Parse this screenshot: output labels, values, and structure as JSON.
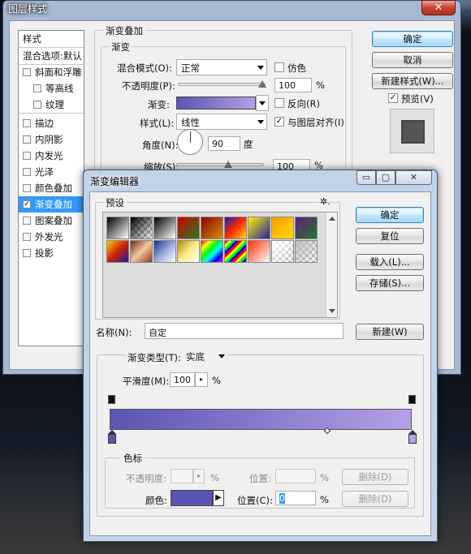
{
  "layer_style": {
    "title": "图层样式",
    "close_glyph": "✕",
    "list_header": "样式",
    "list_items": [
      {
        "label": "混合选项:默认",
        "checkbox": false,
        "checked": false,
        "selected": false
      },
      {
        "label": "斜面和浮雕",
        "checkbox": true,
        "checked": false,
        "selected": false
      },
      {
        "label": "等高线",
        "checkbox": true,
        "checked": false,
        "selected": false
      },
      {
        "label": "纹理",
        "checkbox": true,
        "checked": false,
        "selected": false
      },
      {
        "label": "描边",
        "checkbox": true,
        "checked": false,
        "selected": false
      },
      {
        "label": "内阴影",
        "checkbox": true,
        "checked": false,
        "selected": false
      },
      {
        "label": "内发光",
        "checkbox": true,
        "checked": false,
        "selected": false
      },
      {
        "label": "光泽",
        "checkbox": true,
        "checked": false,
        "selected": false
      },
      {
        "label": "颜色叠加",
        "checkbox": true,
        "checked": false,
        "selected": false
      },
      {
        "label": "渐变叠加",
        "checkbox": true,
        "checked": true,
        "selected": true
      },
      {
        "label": "图案叠加",
        "checkbox": true,
        "checked": false,
        "selected": false
      },
      {
        "label": "外发光",
        "checkbox": true,
        "checked": false,
        "selected": false
      },
      {
        "label": "投影",
        "checkbox": true,
        "checked": false,
        "selected": false
      }
    ],
    "group_title": "渐变叠加",
    "subgroup_title": "渐变",
    "blend_mode_label": "混合模式(O):",
    "blend_mode_value": "正常",
    "dither_label": "仿色",
    "opacity_label": "不透明度(P):",
    "opacity_value": "100",
    "percent": "%",
    "gradient_label": "渐变:",
    "reverse_label": "反向(R)",
    "style_label": "样式(L):",
    "style_value": "线性",
    "align_label": "与图层对齐(I)",
    "angle_label": "角度(N):",
    "angle_value": "90",
    "degree": "度",
    "scale_label": "缩放(S):",
    "scale_value": "100",
    "buttons": {
      "ok": "确定",
      "cancel": "取消",
      "new_style": "新建样式(W)...",
      "preview": "预览(V)"
    }
  },
  "gradient_editor": {
    "title": "渐变编辑器",
    "presets_label": "预设",
    "gear_glyph": "✲.",
    "name_label": "名称(N):",
    "name_value": "自定",
    "new_button": "新建(W)",
    "buttons": {
      "ok": "确定",
      "reset": "复位",
      "load": "载入(L)...",
      "save": "存储(S)..."
    },
    "type_label": "渐变类型(T):",
    "type_value": "实底",
    "smooth_label": "平滑度(M):",
    "smooth_value": "100",
    "percent": "%",
    "stops_group": "色标",
    "opacity_label": "不透明度:",
    "location_label_disabled": "位置:",
    "delete_label": "删除(D)",
    "color_label": "颜色:",
    "location_label": "位置(C):",
    "location_value": "0",
    "stop_color": "#5a55b2",
    "end_color": "#b59fe7",
    "win_minimize_glyph": "▭",
    "win_maximize_glyph": "▢",
    "win_close_glyph": "✕"
  }
}
